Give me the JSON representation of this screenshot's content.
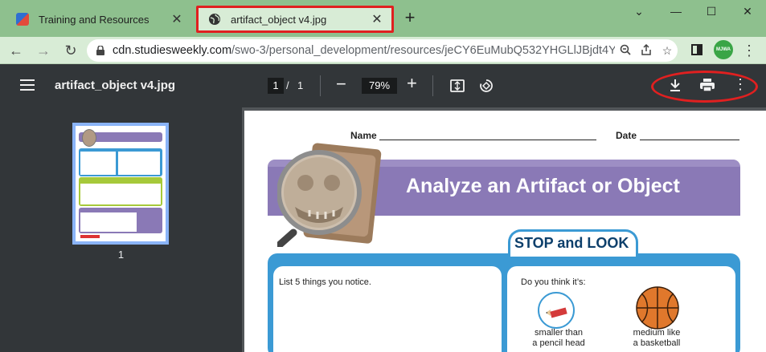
{
  "tabs": [
    {
      "title": "Training and Resources",
      "favicon": "studies-weekly-icon"
    },
    {
      "title": "artifact_object v4.jpg",
      "favicon": "globe-icon",
      "active": true
    }
  ],
  "window": {
    "minimize": "—",
    "maximize": "☐",
    "close": "✕",
    "collapse": "⌄"
  },
  "address": {
    "host": "cdn.studiesweekly.com",
    "path": "/swo-3/personal_development/resources/jeCY6EuMubQ532YHGLlJBjdt4Y...",
    "profile": "MJWA"
  },
  "pdf": {
    "title": "artifact_object v4.jpg",
    "page_current": "1",
    "page_sep": "/",
    "page_total": "1",
    "zoom": "79%",
    "thumbnail_page": "1"
  },
  "document": {
    "name_label": "Name",
    "date_label": "Date",
    "heading": "Analyze an Artifact or Object",
    "section": "STOP and LOOK",
    "prompt1": "List 5 things you notice.",
    "prompt2": "Do you think it’s:",
    "option1_line1": "smaller than",
    "option1_line2": "a pencil head",
    "option2_line1": "medium like",
    "option2_line2": "a basketball"
  },
  "colors": {
    "accent_annotation": "#e02020",
    "tab_bg": "#8ec08e",
    "banner": "#8a79b6",
    "blue": "#3b9ad4"
  }
}
